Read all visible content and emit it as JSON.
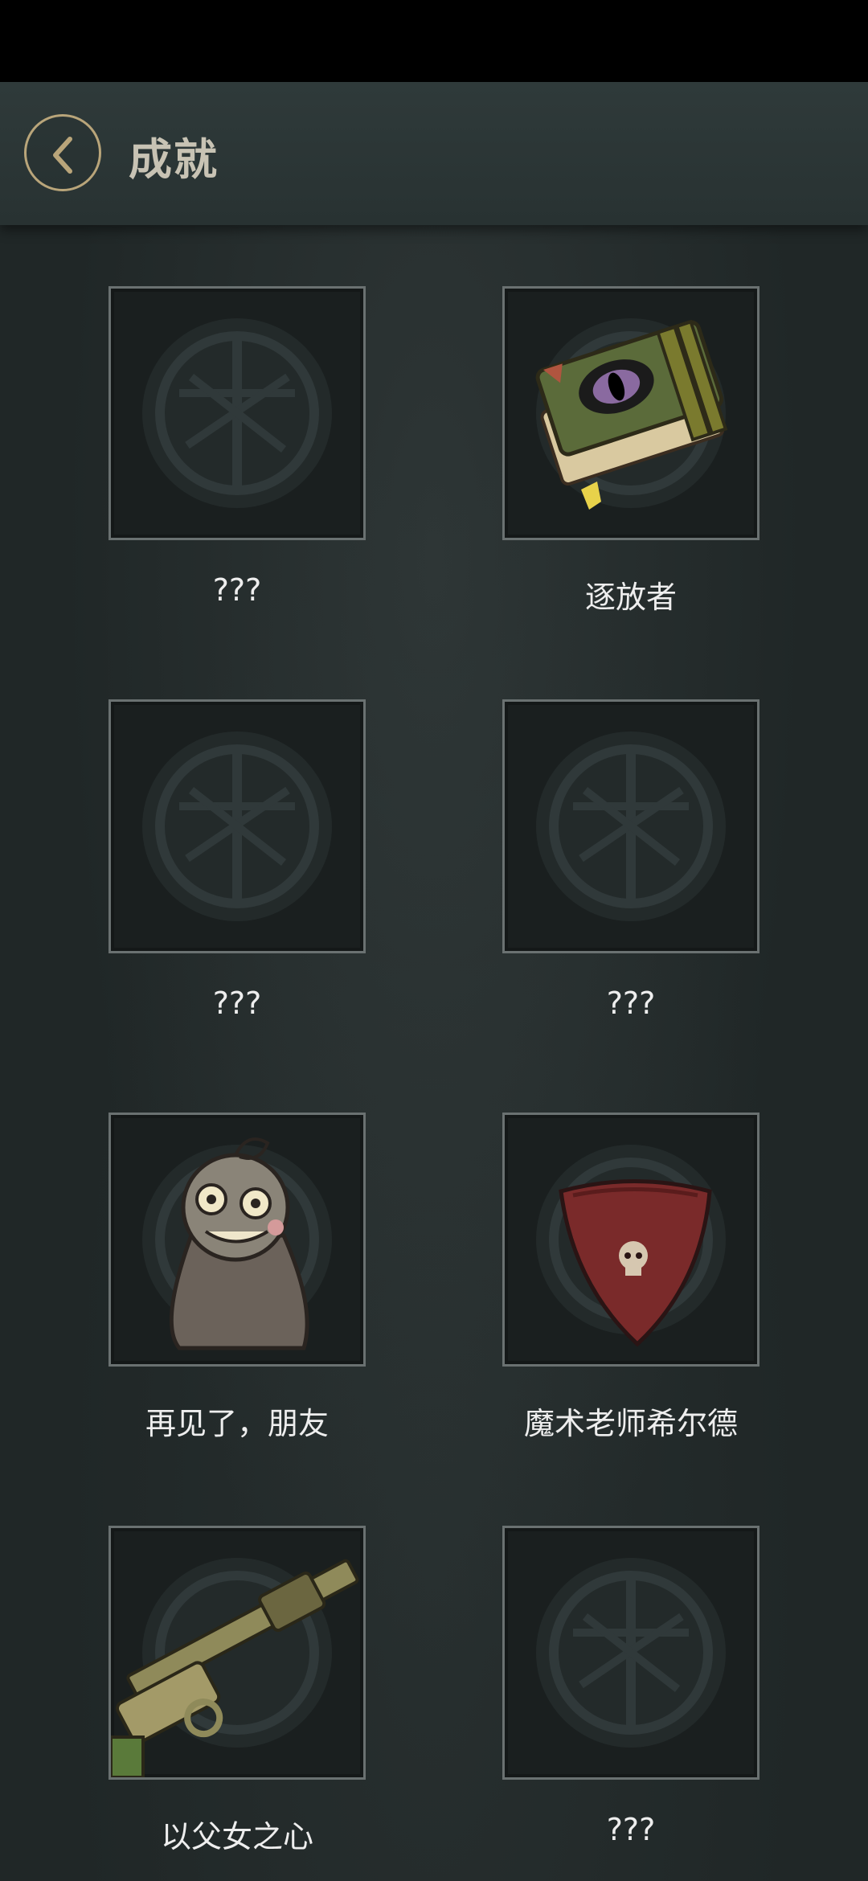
{
  "header": {
    "title": "成就",
    "back_icon": "chevron-left-icon"
  },
  "colors": {
    "header_bg": "#2c3636",
    "accent_gold": "#b9a57a",
    "frame_border": "#6a7171",
    "text": "#eeeeee"
  },
  "achievements": [
    {
      "label": "???",
      "unlocked": false,
      "icon": "locked-seal-icon"
    },
    {
      "label": "逐放者",
      "unlocked": true,
      "icon": "eye-book-icon"
    },
    {
      "label": "???",
      "unlocked": false,
      "icon": "locked-seal-icon"
    },
    {
      "label": "???",
      "unlocked": false,
      "icon": "locked-seal-icon"
    },
    {
      "label": "再见了，朋友",
      "unlocked": true,
      "icon": "ghost-doll-icon"
    },
    {
      "label": "魔术老师希尔德",
      "unlocked": true,
      "icon": "red-bandana-icon"
    },
    {
      "label": "以父女之心",
      "unlocked": true,
      "icon": "shotgun-icon"
    },
    {
      "label": "???",
      "unlocked": false,
      "icon": "locked-seal-icon"
    }
  ]
}
